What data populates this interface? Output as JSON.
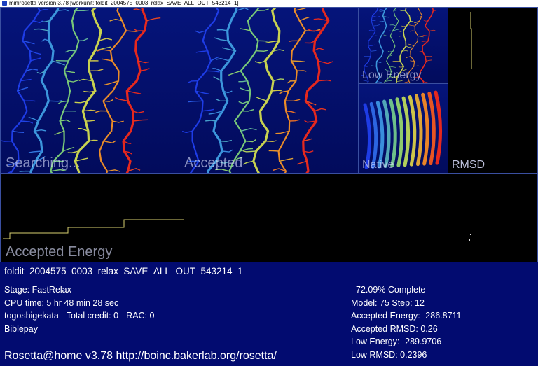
{
  "window": {
    "title": "minirosetta version 3.78 [workunit: foldit_2004575_0003_relax_SAVE_ALL_OUT_543214_1]"
  },
  "panels": {
    "searching": "Searching...",
    "accepted": "Accepted",
    "low_energy": "Low Energy",
    "native": "Native",
    "rmsd": "RMSD",
    "accepted_energy": "Accepted Energy"
  },
  "energy_trace": {
    "description_note": "",
    "steps": [
      0.0,
      0.0,
      0.35,
      0.47,
      0.6
    ]
  },
  "info": {
    "job_name": "foldit_2004575_0003_relax_SAVE_ALL_OUT_543214_1",
    "stage": "Stage: FastRelax",
    "cpu_time": "CPU time: 5 hr 48 min 28 sec",
    "user_credit": "togoshigekata - Total credit: 0 - RAC: 0",
    "team": "Biblepay",
    "progress": "72.09% Complete",
    "progress_value": 72.09,
    "model_step": "Model: 75  Step: 12",
    "accepted_energy": "Accepted Energy: -286.8711",
    "accepted_rmsd": "Accepted RMSD: 0.26",
    "low_energy": "Low Energy: -289.9706",
    "low_rmsd": "Low RMSD: 0.2396",
    "footer": "Rosetta@home v3.78 http://boinc.bakerlab.org/rosetta/"
  },
  "colors": {
    "panel_bg": "#04127a",
    "info_bg": "#020b70",
    "trace": "#d8d070"
  }
}
